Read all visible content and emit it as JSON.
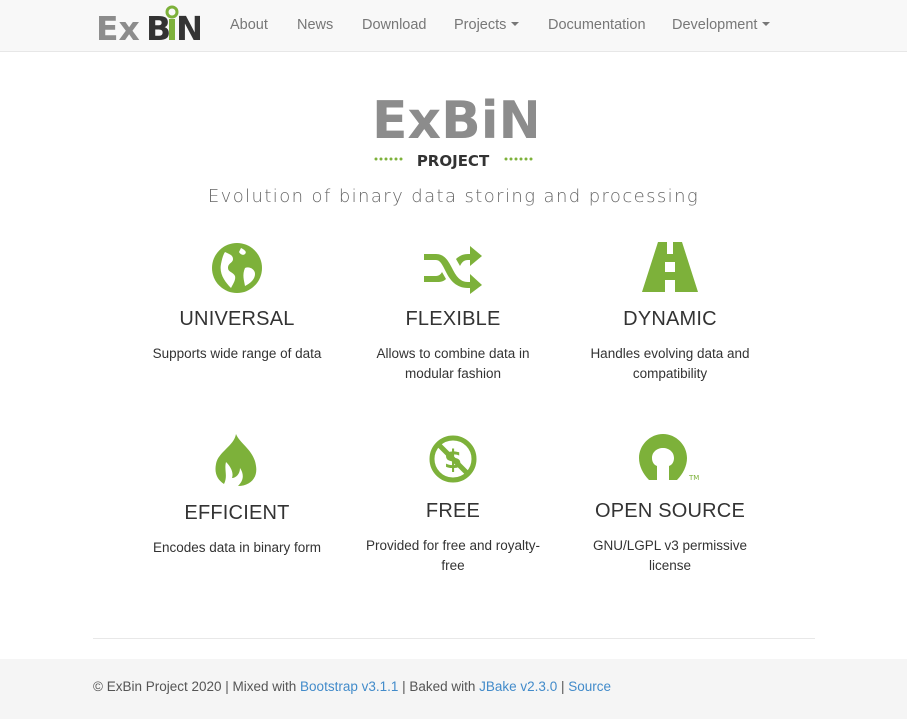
{
  "navbar": {
    "brand_parts": [
      "Ex",
      "B",
      "i",
      "N"
    ],
    "items": [
      {
        "label": "About"
      },
      {
        "label": "News"
      },
      {
        "label": "Download"
      },
      {
        "label": "Projects"
      },
      {
        "label": "Documentation"
      },
      {
        "label": "Development"
      }
    ]
  },
  "hero": {
    "logo_word": "ExBiN",
    "logo_sub": "PROJECT",
    "tagline": "Evolution of binary data storing and processing"
  },
  "features": [
    {
      "icon": "globe-icon",
      "title": "UNIVERSAL",
      "desc": "Supports wide range of data"
    },
    {
      "icon": "shuffle-icon",
      "title": "FLEXIBLE",
      "desc": "Allows to combine data in modular fashion"
    },
    {
      "icon": "road-icon",
      "title": "DYNAMIC",
      "desc": "Handles evolving data and compatibility"
    },
    {
      "icon": "fire-icon",
      "title": "EFFICIENT",
      "desc": "Encodes data in binary form"
    },
    {
      "icon": "no-dollar-icon",
      "title": "FREE",
      "desc": "Provided for free and royalty-free"
    },
    {
      "icon": "open-source-icon",
      "title": "OPEN SOURCE",
      "desc": "GNU/LGPL v3 permissive license"
    }
  ],
  "footer": {
    "prefix": "© ExBin Project 2020 | Mixed with ",
    "bootstrap": "Bootstrap v3.1.1",
    "baked": " | Baked with ",
    "jbake": "JBake v2.3.0",
    "sep": " | ",
    "source": "Source"
  },
  "colors": {
    "accent_green": "#7db13a",
    "logo_gray": "#8c8c8c",
    "link_blue": "#428bca"
  }
}
